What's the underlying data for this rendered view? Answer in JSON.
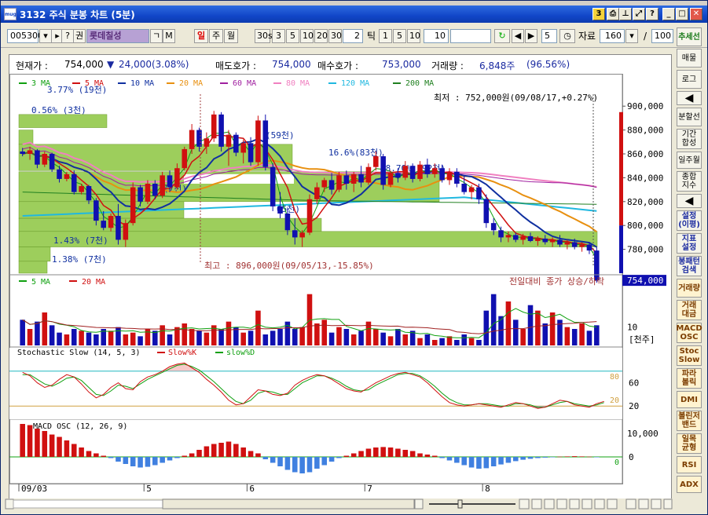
{
  "window": {
    "title": "3132 주식 분봉 차트 (5분)",
    "app_icon": "mug",
    "badge_num": "3",
    "help_label": "?"
  },
  "toolbar": {
    "code": "005300",
    "name": "롯데칠성",
    "help": "?",
    "tab": "권",
    "search1": "ㄱ",
    "search2": "M",
    "period_day": "일",
    "period_week": "주",
    "period_month": "월",
    "min_label": "30s",
    "minutes": [
      "3",
      "5",
      "10",
      "20",
      "30"
    ],
    "min_input": "2",
    "tick_label": "틱",
    "ticks": [
      "1",
      "5",
      "10"
    ],
    "tick_input": "10",
    "nav_input": "5",
    "data_label": "자료",
    "data_count": "160",
    "slash": "/",
    "data_total": "100"
  },
  "sidebar": {
    "items": [
      {
        "label": "추세선",
        "style": "green"
      },
      {
        "label": "매물",
        "style": ""
      },
      {
        "label": "로그",
        "style": ""
      },
      {
        "label": "◀",
        "style": "dark"
      },
      {
        "label": "분할선",
        "style": ""
      },
      {
        "label": "기간 합성",
        "style": ""
      },
      {
        "label": "일주월",
        "style": ""
      },
      {
        "label": "종합 지수",
        "style": ""
      },
      {
        "label": "◀",
        "style": "dark"
      },
      {
        "label": "설정 (이평)",
        "style": "blue"
      },
      {
        "label": "지표 설정",
        "style": "blue"
      },
      {
        "label": "봉패턴 검색",
        "style": "blue"
      },
      {
        "label": "거래량",
        "style": "brown"
      },
      {
        "label": "거래 대금",
        "style": "brown"
      },
      {
        "label": "MACD OSC",
        "style": "brown"
      },
      {
        "label": "Stoc Slow",
        "style": "brown"
      },
      {
        "label": "파라 볼릭",
        "style": "brown"
      },
      {
        "label": "DMI",
        "style": "brown"
      },
      {
        "label": "볼린저 밴드",
        "style": "brown"
      },
      {
        "label": "일목 균형",
        "style": "brown"
      },
      {
        "label": "RSI",
        "style": "brown"
      },
      {
        "label": "ADX",
        "style": "brown"
      }
    ]
  },
  "info": {
    "price_label": "현재가 :",
    "price": "754,000",
    "change_arrow": "▼",
    "change": "24,000(3.08%)",
    "ask_label": "매도호가 :",
    "ask": "754,000",
    "bid_label": "매수호가 :",
    "bid": "753,000",
    "vol_label": "거래량 :",
    "vol": "6,848주",
    "vol_pct": "(96.56%)"
  },
  "colors": {
    "up": "#D01010",
    "down": "#1010B0",
    "profile": "#8CC63F",
    "ma3": "#10A010",
    "ma5": "#D01010",
    "ma10": "#1030A0",
    "ma20": "#E89010",
    "ma60": "#A020A0",
    "ma80": "#F080C0",
    "ma120": "#20B8E0",
    "ma200": "#208020"
  },
  "chart_data": [
    {
      "type": "candlestick",
      "panel": "price",
      "legend": [
        "3 MA",
        "5 MA",
        "10 MA",
        "20 MA",
        "60 MA",
        "80 MA",
        "120 MA",
        "200 MA"
      ],
      "ylim": [
        760000,
        910000
      ],
      "y_ticks": [
        "900,000",
        "880,000",
        "860,000",
        "840,000",
        "820,000",
        "800,000",
        "780,000"
      ],
      "current_price_label": "754,000",
      "x_ticks": [
        "09/03",
        "5",
        "6",
        "7",
        "8"
      ],
      "annotations": {
        "low": "최저 : 752,000원(09/08/17,+0.27%)",
        "high": "최고 : 896,000원(09/05/13,-15.85%)"
      },
      "volume_profile": [
        {
          "label": "3.77% (19천)"
        },
        {
          "label": "0.56% (3천)"
        },
        {
          "label": "(59천)"
        },
        {
          "label": "16.6%(83천)"
        },
        {
          "label": "18.70% (92천)"
        },
        {
          "label": "(7천)"
        },
        {
          "label": "65천)"
        },
        {
          "label": "1.43% (7천)"
        },
        {
          "label": "1.38% (7천)"
        }
      ],
      "candles": [
        [
          862000,
          865000,
          858000,
          860000
        ],
        [
          860000,
          866000,
          855000,
          863000
        ],
        [
          863000,
          864000,
          848000,
          851000
        ],
        [
          851000,
          862000,
          849000,
          860000
        ],
        [
          860000,
          861000,
          845000,
          847000
        ],
        [
          847000,
          850000,
          836000,
          839000
        ],
        [
          839000,
          845000,
          837000,
          843000
        ],
        [
          843000,
          846000,
          826000,
          828000
        ],
        [
          828000,
          835000,
          826000,
          833000
        ],
        [
          833000,
          834000,
          818000,
          821000
        ],
        [
          821000,
          823000,
          800000,
          804000
        ],
        [
          804000,
          812000,
          796000,
          798000
        ],
        [
          798000,
          810000,
          795000,
          808000
        ],
        [
          808000,
          818000,
          784000,
          788000
        ],
        [
          788000,
          805000,
          782000,
          802000
        ],
        [
          802000,
          836000,
          800000,
          832000
        ],
        [
          832000,
          834000,
          816000,
          820000
        ],
        [
          820000,
          838000,
          818000,
          835000
        ],
        [
          835000,
          838000,
          822000,
          825000
        ],
        [
          825000,
          845000,
          823000,
          842000
        ],
        [
          842000,
          846000,
          828000,
          832000
        ],
        [
          832000,
          852000,
          830000,
          848000
        ],
        [
          848000,
          866000,
          846000,
          864000
        ],
        [
          864000,
          885000,
          860000,
          880000
        ],
        [
          880000,
          882000,
          862000,
          866000
        ],
        [
          866000,
          878000,
          860000,
          873000
        ],
        [
          873000,
          896000,
          870000,
          893000
        ],
        [
          893000,
          895000,
          862000,
          866000
        ],
        [
          866000,
          880000,
          850000,
          876000
        ],
        [
          876000,
          878000,
          858000,
          861000
        ],
        [
          861000,
          872000,
          852000,
          869000
        ],
        [
          869000,
          874000,
          850000,
          853000
        ],
        [
          853000,
          892000,
          850000,
          888000
        ],
        [
          888000,
          893000,
          846000,
          849000
        ],
        [
          849000,
          852000,
          812000,
          816000
        ],
        [
          816000,
          828000,
          806000,
          810000
        ],
        [
          810000,
          815000,
          792000,
          796000
        ],
        [
          796000,
          806000,
          784000,
          790000
        ],
        [
          790000,
          796000,
          782000,
          794000
        ],
        [
          794000,
          826000,
          792000,
          822000
        ],
        [
          822000,
          836000,
          818000,
          832000
        ],
        [
          832000,
          840000,
          828000,
          838000
        ],
        [
          838000,
          844000,
          826000,
          830000
        ],
        [
          830000,
          845000,
          828000,
          842000
        ],
        [
          842000,
          846000,
          830000,
          835000
        ],
        [
          835000,
          845000,
          828000,
          843000
        ],
        [
          843000,
          850000,
          832000,
          836000
        ],
        [
          836000,
          852000,
          834000,
          849000
        ],
        [
          849000,
          862000,
          846000,
          858000
        ],
        [
          858000,
          860000,
          830000,
          834000
        ],
        [
          834000,
          846000,
          832000,
          844000
        ],
        [
          844000,
          848000,
          836000,
          840000
        ],
        [
          840000,
          854000,
          838000,
          850000
        ],
        [
          850000,
          852000,
          836000,
          839000
        ],
        [
          839000,
          854000,
          837000,
          851000
        ],
        [
          851000,
          856000,
          840000,
          843000
        ],
        [
          843000,
          852000,
          840000,
          848000
        ],
        [
          848000,
          851000,
          836000,
          838000
        ],
        [
          838000,
          848000,
          834000,
          845000
        ],
        [
          845000,
          848000,
          832000,
          835000
        ],
        [
          835000,
          842000,
          826000,
          828000
        ],
        [
          828000,
          834000,
          822000,
          832000
        ],
        [
          832000,
          835000,
          818000,
          822000
        ],
        [
          822000,
          826000,
          798000,
          802000
        ],
        [
          802000,
          806000,
          792000,
          796000
        ],
        [
          796000,
          799000,
          786000,
          790000
        ],
        [
          790000,
          795000,
          786000,
          792000
        ],
        [
          792000,
          794000,
          786000,
          788000
        ],
        [
          788000,
          793000,
          784000,
          791000
        ],
        [
          791000,
          794000,
          786000,
          787000
        ],
        [
          787000,
          791000,
          783000,
          789000
        ],
        [
          789000,
          792000,
          784000,
          786000
        ],
        [
          786000,
          790000,
          782000,
          788000
        ],
        [
          788000,
          792000,
          782000,
          784000
        ],
        [
          784000,
          788000,
          780000,
          786000
        ],
        [
          786000,
          789000,
          780000,
          782000
        ],
        [
          782000,
          786000,
          778000,
          784000
        ],
        [
          784000,
          786000,
          776000,
          779000
        ],
        [
          779000,
          782000,
          752000,
          754000
        ]
      ]
    },
    {
      "type": "bar",
      "panel": "volume",
      "legend": [
        "5 MA",
        "20 MA"
      ],
      "note": "전일대비 종가 상승/하락",
      "y_ticks": [
        "10"
      ],
      "unit": "[천주]",
      "values": [
        14,
        9,
        13,
        18,
        11,
        7,
        6,
        9,
        8,
        7,
        6,
        9,
        8,
        10,
        6,
        7,
        5,
        9,
        8,
        11,
        6,
        10,
        12,
        9,
        8,
        7,
        11,
        9,
        13,
        10,
        7,
        8,
        19,
        6,
        8,
        9,
        13,
        9,
        10,
        28,
        12,
        14,
        7,
        10,
        9,
        6,
        8,
        13,
        9,
        7,
        5,
        9,
        6,
        8,
        4,
        6,
        3,
        4,
        5,
        3,
        6,
        4,
        3,
        19,
        28,
        16,
        24,
        14,
        9,
        22,
        19,
        12,
        18,
        14,
        10,
        9,
        12,
        8,
        11,
        10,
        12,
        9
      ]
    },
    {
      "type": "line",
      "panel": "stochastic",
      "legend": [
        "Stochastic Slow (14, 5, 3)",
        "Slow%K",
        "slow%D"
      ],
      "y_ticks": [
        "80",
        "60",
        "20"
      ],
      "k": [
        78,
        72,
        60,
        52,
        56,
        66,
        74,
        70,
        58,
        44,
        34,
        40,
        52,
        60,
        50,
        48,
        62,
        70,
        74,
        80,
        88,
        92,
        94,
        86,
        78,
        66,
        56,
        44,
        30,
        22,
        24,
        36,
        48,
        46,
        40,
        38,
        42,
        56,
        64,
        70,
        74,
        72,
        66,
        58,
        50,
        46,
        44,
        52,
        60,
        66,
        72,
        76,
        78,
        74,
        70,
        60,
        48,
        36,
        26,
        22,
        20,
        22,
        24,
        22,
        20,
        18,
        22,
        26,
        24,
        20,
        16,
        18,
        24,
        30,
        28,
        22,
        20,
        18,
        24,
        28
      ],
      "d": [
        74,
        74,
        66,
        58,
        54,
        60,
        68,
        70,
        64,
        52,
        40,
        38,
        46,
        56,
        54,
        50,
        58,
        66,
        72,
        78,
        84,
        90,
        92,
        88,
        82,
        72,
        62,
        50,
        38,
        28,
        24,
        30,
        42,
        46,
        44,
        40,
        40,
        50,
        60,
        66,
        72,
        72,
        68,
        62,
        54,
        48,
        46,
        48,
        56,
        62,
        68,
        74,
        76,
        76,
        72,
        64,
        54,
        42,
        32,
        26,
        22,
        22,
        24,
        24,
        22,
        20,
        20,
        24,
        24,
        22,
        18,
        18,
        22,
        26,
        28,
        24,
        22,
        20,
        22,
        26
      ]
    },
    {
      "type": "bar",
      "panel": "macd",
      "legend": [
        "MACD OSC (12, 26, 9)"
      ],
      "y_ticks": [
        "10,000",
        "0"
      ],
      "values": [
        14000,
        13500,
        12000,
        11000,
        9500,
        8500,
        7000,
        5500,
        4000,
        2500,
        1500,
        500,
        -500,
        -2000,
        -3000,
        -4000,
        -4500,
        -4200,
        -3500,
        -2500,
        -1500,
        -500,
        500,
        1500,
        3000,
        4500,
        5500,
        6000,
        6500,
        5500,
        4000,
        2500,
        1500,
        -1000,
        -2500,
        -4000,
        -5500,
        -6500,
        -7000,
        -6500,
        -5000,
        -3500,
        -2000,
        -500,
        500,
        1500,
        2500,
        3500,
        4000,
        4200,
        4000,
        3500,
        3000,
        2500,
        1500,
        1000,
        500,
        -500,
        -1500,
        -2500,
        -3500,
        -4500,
        -5000,
        -4800,
        -4000,
        -3200,
        -2500,
        -1800,
        -1200,
        -800,
        -500,
        -300,
        -100,
        100,
        200,
        300,
        200,
        100,
        -100,
        -300,
        -500
      ]
    }
  ]
}
